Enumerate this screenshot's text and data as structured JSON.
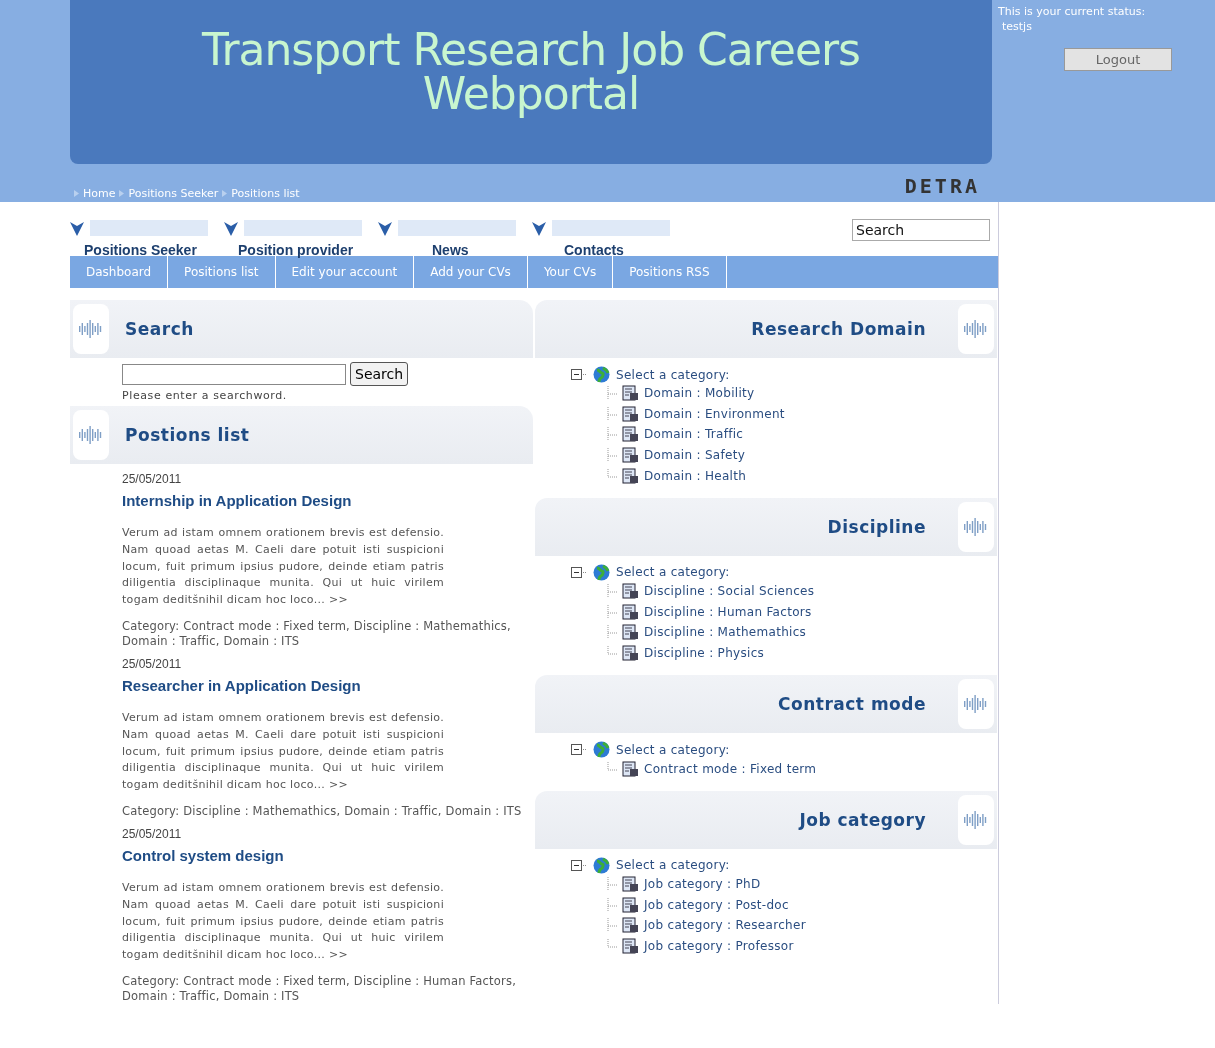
{
  "header": {
    "title_lines": [
      "Transport Research Job Careers",
      "Webportal"
    ],
    "logo": "DETRA"
  },
  "user_panel": {
    "status_label": "This is your current status:",
    "user": "testjs",
    "logout": "Logout"
  },
  "breadcrumb": [
    "Home",
    "Positions Seeker",
    "Positions list"
  ],
  "main_tabs": [
    {
      "label": "Positions Seeker"
    },
    {
      "label": "Position provider"
    },
    {
      "label": "News"
    },
    {
      "label": "Contacts"
    }
  ],
  "site_search": {
    "placeholder": "Search"
  },
  "submenu": [
    "Dashboard",
    "Positions list",
    "Edit your account",
    "Add your CVs",
    "Your CVs",
    "Positions RSS"
  ],
  "search_panel": {
    "title": "Search",
    "button": "Search",
    "hint": "Please enter a searchword."
  },
  "positions_panel": {
    "title": "Postions list",
    "items": [
      {
        "date": "25/05/2011",
        "title": "Internship in Application Design",
        "summary": "Verum ad istam omnem orationem brevis est defensio. Nam quoad aetas M. Caeli dare potuit isti suspicioni locum, fuit primum ipsius pudore, deinde etiam patris diligentia disciplinaque munita. Qui ut huic virilem togam deditšnihil dicam hoc loco...",
        "more": ">>",
        "category": "Category: Contract mode : Fixed term, Discipline : Mathemathics, Domain : Traffic, Domain : ITS"
      },
      {
        "date": "25/05/2011",
        "title": "Researcher in Application Design",
        "summary": "Verum ad istam omnem orationem brevis est defensio. Nam quoad aetas M. Caeli dare potuit isti suspicioni locum, fuit primum ipsius pudore, deinde etiam patris diligentia disciplinaque munita. Qui ut huic virilem togam deditšnihil dicam hoc loco...",
        "more": ">>",
        "category": "Category: Discipline : Mathemathics, Domain : Traffic, Domain : ITS"
      },
      {
        "date": "25/05/2011",
        "title": "Control system design",
        "summary": "Verum ad istam omnem orationem brevis est defensio. Nam quoad aetas M. Caeli dare potuit isti suspicioni locum, fuit primum ipsius pudore, deinde etiam patris diligentia disciplinaque munita. Qui ut huic virilem togam deditšnihil dicam hoc loco...",
        "more": ">>",
        "category": "Category: Contract mode : Fixed term, Discipline : Human Factors, Domain : Traffic, Domain : ITS"
      }
    ]
  },
  "category_panels": [
    {
      "title": "Research Domain",
      "tree": {
        "label": "Select a category:",
        "expanded": true,
        "children": [
          {
            "label": "Domain : Mobility"
          },
          {
            "label": "Domain : Environment"
          },
          {
            "label": "Domain : Traffic"
          },
          {
            "label": "Domain : Safety"
          },
          {
            "label": "Domain : Health"
          }
        ]
      }
    },
    {
      "title": "Discipline",
      "tree": {
        "label": "Select a category:",
        "expanded": true,
        "children": [
          {
            "label": "Discipline : Social Sciences"
          },
          {
            "label": "Discipline : Human Factors"
          },
          {
            "label": "Discipline : Mathemathics"
          },
          {
            "label": "Discipline : Physics"
          }
        ]
      }
    },
    {
      "title": "Contract mode",
      "tree": {
        "label": "Select a category:",
        "expanded": true,
        "children": [
          {
            "label": "Contract mode : Fixed term"
          }
        ]
      }
    },
    {
      "title": "Job category",
      "tree": {
        "label": "Select a category:",
        "expanded": true,
        "children": [
          {
            "label": "Job category : PhD"
          },
          {
            "label": "Job category : Post-doc"
          },
          {
            "label": "Job category : Researcher"
          },
          {
            "label": "Job category : Professor"
          }
        ]
      }
    }
  ]
}
